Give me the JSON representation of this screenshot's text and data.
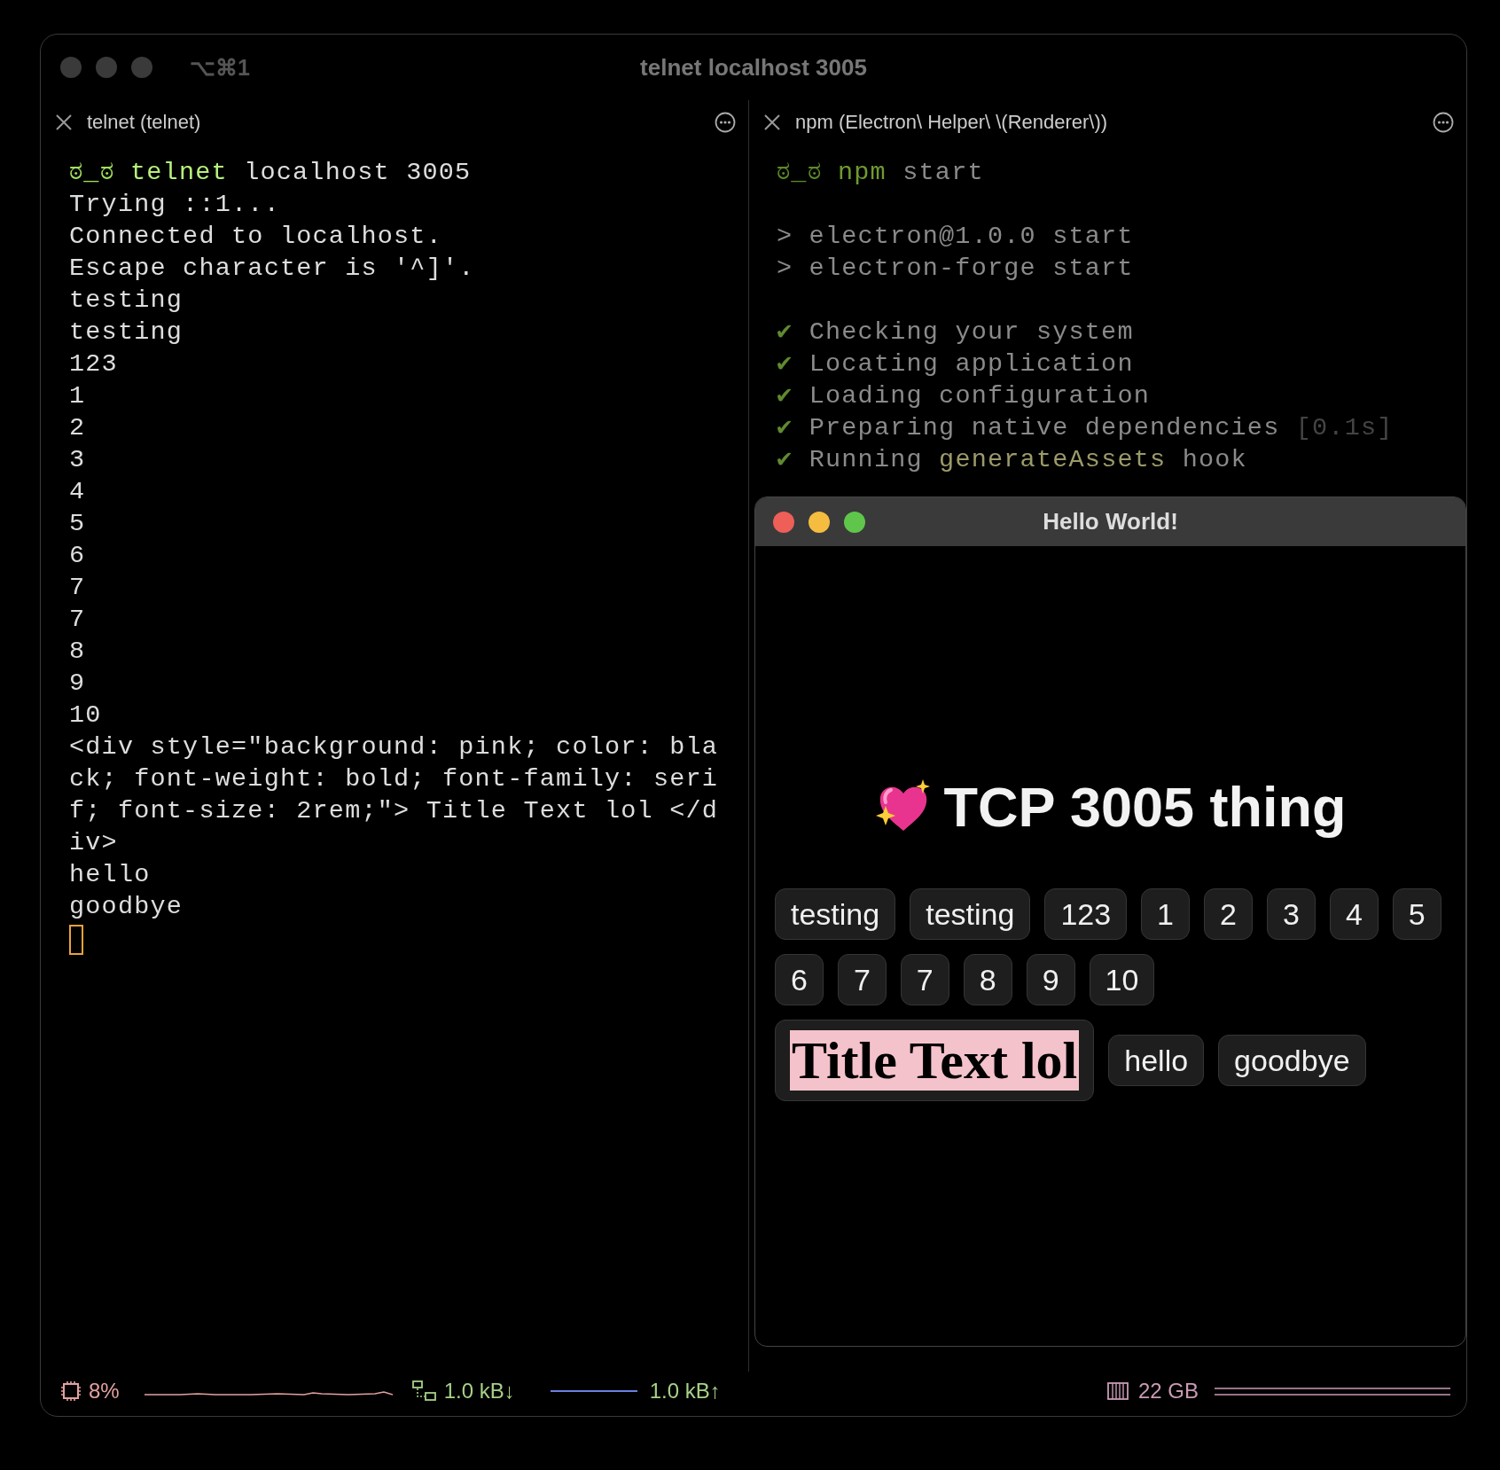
{
  "window": {
    "title": "telnet localhost 3005",
    "shortcut": "⌥⌘1"
  },
  "panes": [
    {
      "tab_title": "telnet (telnet)",
      "cursor": true,
      "lines": [
        {
          "segments": [
            {
              "text": "ಠ_ಠ ",
              "kind": "prompt"
            },
            {
              "text": "telnet",
              "kind": "command"
            },
            {
              "text": " localhost 3005",
              "kind": "text"
            }
          ]
        },
        {
          "segments": [
            {
              "text": "Trying ::1...",
              "kind": "text"
            }
          ]
        },
        {
          "segments": [
            {
              "text": "Connected to localhost.",
              "kind": "text"
            }
          ]
        },
        {
          "segments": [
            {
              "text": "Escape character is '^]'.",
              "kind": "text"
            }
          ]
        },
        {
          "segments": [
            {
              "text": "testing",
              "kind": "text"
            }
          ]
        },
        {
          "segments": [
            {
              "text": "testing",
              "kind": "text"
            }
          ]
        },
        {
          "segments": [
            {
              "text": "123",
              "kind": "text"
            }
          ]
        },
        {
          "segments": [
            {
              "text": "1",
              "kind": "text"
            }
          ]
        },
        {
          "segments": [
            {
              "text": "2",
              "kind": "text"
            }
          ]
        },
        {
          "segments": [
            {
              "text": "3",
              "kind": "text"
            }
          ]
        },
        {
          "segments": [
            {
              "text": "4",
              "kind": "text"
            }
          ]
        },
        {
          "segments": [
            {
              "text": "5",
              "kind": "text"
            }
          ]
        },
        {
          "segments": [
            {
              "text": "6",
              "kind": "text"
            }
          ]
        },
        {
          "segments": [
            {
              "text": "7",
              "kind": "text"
            }
          ]
        },
        {
          "segments": [
            {
              "text": "7",
              "kind": "text"
            }
          ]
        },
        {
          "segments": [
            {
              "text": "8",
              "kind": "text"
            }
          ]
        },
        {
          "segments": [
            {
              "text": "9",
              "kind": "text"
            }
          ]
        },
        {
          "segments": [
            {
              "text": "10",
              "kind": "text"
            }
          ]
        },
        {
          "segments": [
            {
              "text": "<div style=\"background: pink; color: bla",
              "kind": "text"
            }
          ]
        },
        {
          "segments": [
            {
              "text": "ck; font-weight: bold; font-family: seri",
              "kind": "text"
            }
          ]
        },
        {
          "segments": [
            {
              "text": "f; font-size: 2rem;\"> Title Text lol </d",
              "kind": "text"
            }
          ]
        },
        {
          "segments": [
            {
              "text": "iv>",
              "kind": "text"
            }
          ]
        },
        {
          "segments": [
            {
              "text": "hello",
              "kind": "text"
            }
          ]
        },
        {
          "segments": [
            {
              "text": "goodbye",
              "kind": "text"
            }
          ]
        }
      ]
    },
    {
      "tab_title": "npm (Electron\\ Helper\\ \\(Renderer\\))",
      "lines": [
        {
          "segments": [
            {
              "text": "ಠ_ಠ ",
              "kind": "prompt_dim"
            },
            {
              "text": "npm",
              "kind": "command_dim"
            },
            {
              "text": " start",
              "kind": "dim"
            }
          ]
        },
        {
          "blank_before": true,
          "segments": [
            {
              "text": "> electron@1.0.0 start",
              "kind": "dim"
            }
          ]
        },
        {
          "segments": [
            {
              "text": "> electron-forge start",
              "kind": "dim"
            }
          ]
        },
        {
          "blank_before": true,
          "segments": [
            {
              "text": "✔ ",
              "kind": "check"
            },
            {
              "text": "Checking your system",
              "kind": "dim"
            }
          ]
        },
        {
          "segments": [
            {
              "text": "✔ ",
              "kind": "check"
            },
            {
              "text": "Locating application",
              "kind": "dim"
            }
          ]
        },
        {
          "segments": [
            {
              "text": "✔ ",
              "kind": "check"
            },
            {
              "text": "Loading configuration",
              "kind": "dim"
            }
          ]
        },
        {
          "segments": [
            {
              "text": "✔ ",
              "kind": "check"
            },
            {
              "text": "Preparing native dependencies ",
              "kind": "dim"
            },
            {
              "text": "[0.1s]",
              "kind": "faint"
            }
          ]
        },
        {
          "segments": [
            {
              "text": "✔ ",
              "kind": "check"
            },
            {
              "text": "Running ",
              "kind": "dim"
            },
            {
              "text": "generateAssets",
              "kind": "highlight"
            },
            {
              "text": " hook",
              "kind": "dim"
            }
          ]
        }
      ]
    }
  ],
  "app_window": {
    "title": "Hello World!",
    "heading": "TCP 3005 thing",
    "chips": [
      {
        "text": "testing",
        "kind": "plain"
      },
      {
        "text": "testing",
        "kind": "plain"
      },
      {
        "text": "123",
        "kind": "plain"
      },
      {
        "text": "1",
        "kind": "plain"
      },
      {
        "text": "2",
        "kind": "plain"
      },
      {
        "text": "3",
        "kind": "plain"
      },
      {
        "text": "4",
        "kind": "plain"
      },
      {
        "text": "5",
        "kind": "plain"
      },
      {
        "text": "6",
        "kind": "plain"
      },
      {
        "text": "7",
        "kind": "plain"
      },
      {
        "text": "7",
        "kind": "plain"
      },
      {
        "text": "8",
        "kind": "plain"
      },
      {
        "text": "9",
        "kind": "plain"
      },
      {
        "text": "10",
        "kind": "plain"
      },
      {
        "text": "Title Text lol",
        "kind": "styled"
      },
      {
        "text": "hello",
        "kind": "plain"
      },
      {
        "text": "goodbye",
        "kind": "plain"
      }
    ]
  },
  "status_bar": {
    "cpu": "8%",
    "network_down": "1.0 kB↓",
    "network_up": "1.0 kB↑",
    "memory": "22 GB"
  }
}
